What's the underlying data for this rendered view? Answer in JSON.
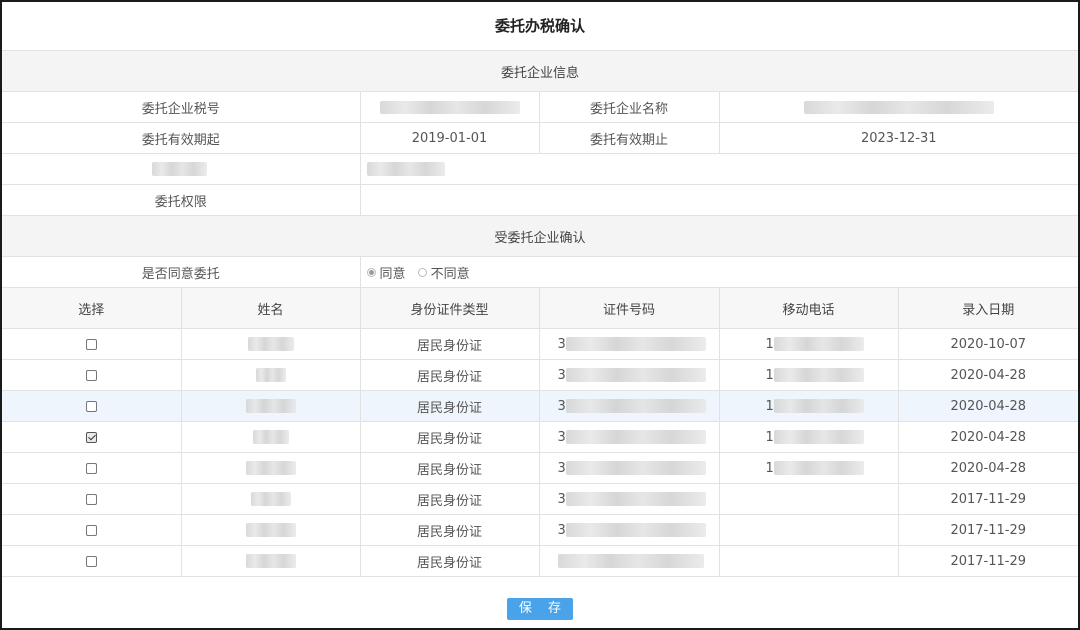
{
  "title": "委托办税确认",
  "sections": {
    "enterprise_info": "委托企业信息",
    "acceptor_confirm": "受委托企业确认"
  },
  "enterprise": {
    "tax_no_label": "委托企业税号",
    "tax_no_value": "",
    "name_label": "委托企业名称",
    "name_value": "",
    "valid_from_label": "委托有效期起",
    "valid_from_value": "2019-01-01",
    "valid_to_label": "委托有效期止",
    "valid_to_value": "2023-12-31",
    "permission_label": "委托权限",
    "permission_value": ""
  },
  "consent": {
    "label": "是否同意委托",
    "options": [
      "同意",
      "不同意"
    ],
    "selected": "同意"
  },
  "table": {
    "headers": [
      "选择",
      "姓名",
      "身份证件类型",
      "证件号码",
      "移动电话",
      "录入日期"
    ],
    "rows": [
      {
        "checked": false,
        "id_type": "居民身份证",
        "id_prefix": "3",
        "phone_prefix": "1",
        "date": "2020-10-07"
      },
      {
        "checked": false,
        "id_type": "居民身份证",
        "id_prefix": "3",
        "phone_prefix": "1",
        "date": "2020-04-28"
      },
      {
        "checked": false,
        "id_type": "居民身份证",
        "id_prefix": "3",
        "phone_prefix": "1",
        "date": "2020-04-28"
      },
      {
        "checked": true,
        "id_type": "居民身份证",
        "id_prefix": "3",
        "phone_prefix": "1",
        "date": "2020-04-28"
      },
      {
        "checked": false,
        "id_type": "居民身份证",
        "id_prefix": "3",
        "phone_prefix": "1",
        "date": "2020-04-28"
      },
      {
        "checked": false,
        "id_type": "居民身份证",
        "id_prefix": "3",
        "phone_prefix": "",
        "date": "2017-11-29"
      },
      {
        "checked": false,
        "id_type": "居民身份证",
        "id_prefix": "3",
        "phone_prefix": "",
        "date": "2017-11-29"
      },
      {
        "checked": false,
        "id_type": "居民身份证",
        "id_prefix": "",
        "phone_prefix": "",
        "date": "2017-11-29"
      }
    ]
  },
  "save_label": "保 存",
  "colors": {
    "accent": "#4aa3e8",
    "section_bg": "#f4f4f4",
    "selected_row_bg": "#eef5fc",
    "border": "#e2e2e2"
  }
}
